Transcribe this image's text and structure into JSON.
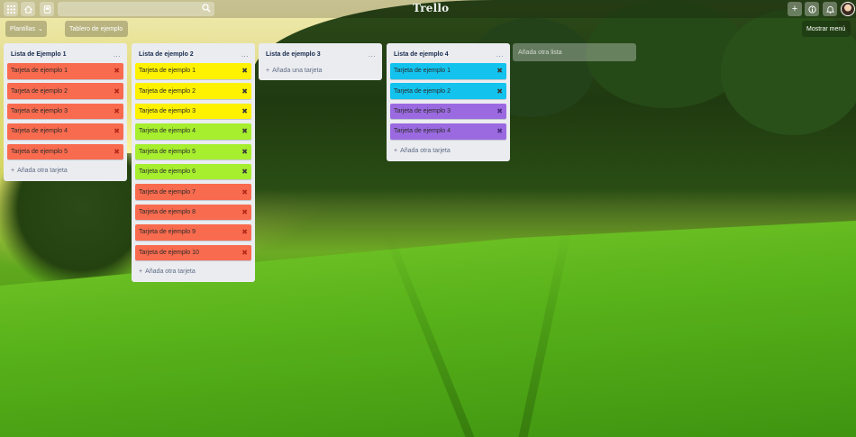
{
  "app": {
    "logo": "Trello"
  },
  "topbar": {
    "search_placeholder": ""
  },
  "board_header": {
    "templates_label": "Plantillas",
    "board_name": "Tablero de ejemplo",
    "show_menu_label": "Mostrar menú"
  },
  "lists": [
    {
      "title": "Lista de Ejemplo 1",
      "menu": "...",
      "add_label": "Añada otra tarjeta",
      "cards": [
        {
          "label": "Tarjeta de ejemplo 1",
          "color": "#f96b4e",
          "delete": "✖"
        },
        {
          "label": "Tarjeta de ejemplo 2",
          "color": "#f96b4e",
          "delete": "✖"
        },
        {
          "label": "Tarjeta de ejemplo 3",
          "color": "#f96b4e",
          "delete": "✖"
        },
        {
          "label": "Tarjeta de ejemplo 4",
          "color": "#f96b4e",
          "delete": "✖"
        },
        {
          "label": "Tarjeta de ejemplo 5",
          "color": "#f96b4e",
          "delete": "✖"
        }
      ]
    },
    {
      "title": "Lista de ejemplo 2",
      "menu": "...",
      "add_label": "Añada otra tarjeta",
      "cards": [
        {
          "label": "Tarjeta de ejemplo 1",
          "color": "#fff200",
          "delete": "✖"
        },
        {
          "label": "Tarjeta de ejemplo 2",
          "color": "#fff200",
          "delete": "✖"
        },
        {
          "label": "Tarjeta de ejemplo 3",
          "color": "#fff200",
          "delete": "✖"
        },
        {
          "label": "Tarjeta de ejemplo 4",
          "color": "#a6ee2e",
          "delete": "✖"
        },
        {
          "label": "Tarjeta de ejemplo 5",
          "color": "#a6ee2e",
          "delete": "✖"
        },
        {
          "label": "Tarjeta de ejemplo 6",
          "color": "#a6ee2e",
          "delete": "✖"
        },
        {
          "label": "Tarjeta de ejemplo 7",
          "color": "#f96b4e",
          "delete": "✖"
        },
        {
          "label": "Tarjeta de ejemplo 8",
          "color": "#f96b4e",
          "delete": "✖"
        },
        {
          "label": "Tarjeta de ejemplo 9",
          "color": "#f96b4e",
          "delete": "✖"
        },
        {
          "label": "Tarjeta de ejemplo 10",
          "color": "#f96b4e",
          "delete": "✖"
        }
      ]
    },
    {
      "title": "Lista de ejemplo 3",
      "menu": "...",
      "add_label": "Añada una tarjeta",
      "cards": []
    },
    {
      "title": "Lista de ejemplo 4",
      "menu": "...",
      "add_label": "Añada otra tarjeta",
      "cards": [
        {
          "label": "Tarjeta de ejemplo 1",
          "color": "#13c3ee",
          "delete": "✖"
        },
        {
          "label": "Tarjeta de ejemplo 2",
          "color": "#13c3ee",
          "delete": "✖"
        },
        {
          "label": "Tarjeta de ejemplo 3",
          "color": "#9b6ae0",
          "delete": "✖"
        },
        {
          "label": "Tarjeta de ejemplo 4",
          "color": "#9b6ae0",
          "delete": "✖"
        }
      ]
    }
  ],
  "add_list_label": "Añada otra lista",
  "icons": {
    "apps": "grid-icon",
    "home": "home-icon",
    "boards": "boards-icon",
    "search": "search-icon",
    "add": "plus-icon",
    "info": "info-icon",
    "notifications": "bell-icon"
  },
  "text_color_on_card": "#2b2b2b"
}
